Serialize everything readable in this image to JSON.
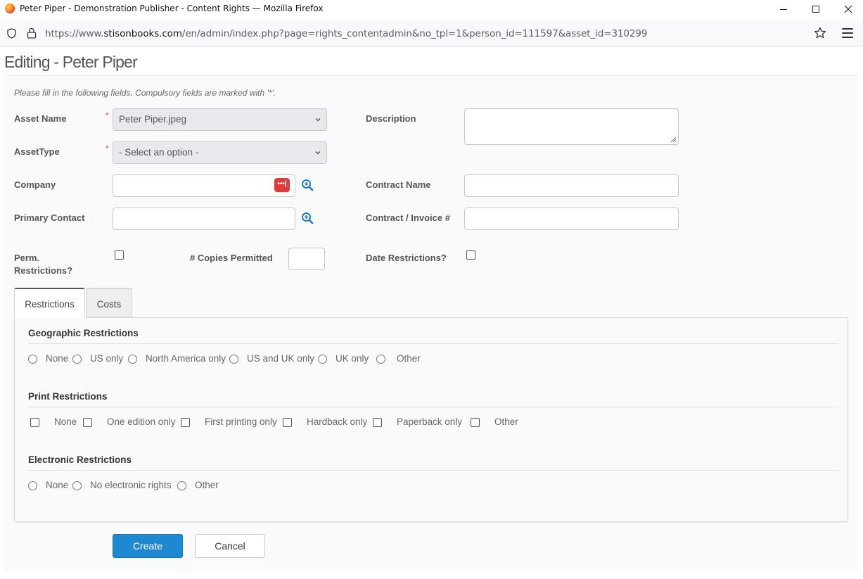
{
  "browser": {
    "window_title": "Peter Piper - Demonstration Publisher - Content Rights — Mozilla Firefox",
    "url_prefix": "https://www.",
    "url_host": "stisonbooks.com",
    "url_path": "/en/admin/index.php?page=rights_contentadmin&no_tpl=1&person_id=111597&asset_id=310299"
  },
  "page": {
    "title": "Editing - Peter Piper",
    "hint": "Please fill in the following fields. Compulsory fields are marked with '*'."
  },
  "form": {
    "asset_name_label": "Asset Name",
    "asset_name_value": "Peter Piper.jpeg",
    "asset_type_label": "AssetType",
    "asset_type_value": "- Select an option -",
    "required_mark": "*",
    "description_label": "Description",
    "company_label": "Company",
    "contract_name_label": "Contract Name",
    "primary_contact_label": "Primary Contact",
    "contract_invoice_label": "Contract / Invoice #",
    "perm_restrictions_label": "Perm. Restrictions?",
    "copies_permitted_label": "# Copies Permitted",
    "date_restrictions_label": "Date Restrictions?",
    "password_icon_text": "•••|"
  },
  "tabs": [
    {
      "label": "Restrictions",
      "active": true
    },
    {
      "label": "Costs",
      "active": false
    }
  ],
  "restrictions": {
    "geographic": {
      "title": "Geographic Restrictions",
      "options": [
        "None",
        "US only",
        "North America only",
        "US and UK only",
        "UK only",
        "Other"
      ]
    },
    "print": {
      "title": "Print Restrictions",
      "options": [
        "None",
        "One edition only",
        "First printing only",
        "Hardback only",
        "Paperback only",
        "Other"
      ]
    },
    "electronic": {
      "title": "Electronic Restrictions",
      "options": [
        "None",
        "No electronic rights",
        "Other"
      ]
    }
  },
  "buttons": {
    "create": "Create",
    "cancel": "Cancel"
  },
  "colors": {
    "primary_button": "#1e88d0",
    "required_star": "#d9534f",
    "password_icon": "#e03a3a",
    "zoom_icon": "#1a7fc1"
  }
}
